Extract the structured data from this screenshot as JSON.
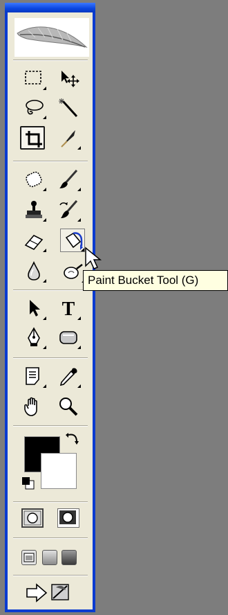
{
  "tooltip": {
    "text": "Paint Bucket Tool (G)"
  },
  "toolbox": {
    "colors": {
      "foreground": "#000000",
      "background": "#ffffff",
      "frame": "#0a3bd0"
    },
    "tools": [
      {
        "id": "marquee",
        "icon": "rectangular-marquee-icon"
      },
      {
        "id": "move",
        "icon": "move-icon"
      },
      {
        "id": "lasso",
        "icon": "lasso-icon"
      },
      {
        "id": "magic-wand",
        "icon": "magic-wand-icon"
      },
      {
        "id": "crop",
        "icon": "crop-icon",
        "selected": true
      },
      {
        "id": "slice",
        "icon": "slice-icon"
      },
      {
        "id": "healing-brush",
        "icon": "healing-brush-icon"
      },
      {
        "id": "brush",
        "icon": "brush-icon"
      },
      {
        "id": "clone-stamp",
        "icon": "clone-stamp-icon"
      },
      {
        "id": "history-brush",
        "icon": "history-brush-icon"
      },
      {
        "id": "eraser",
        "icon": "eraser-icon"
      },
      {
        "id": "paint-bucket",
        "icon": "paint-bucket-icon",
        "hover": true
      },
      {
        "id": "blur",
        "icon": "blur-icon"
      },
      {
        "id": "dodge",
        "icon": "dodge-icon"
      },
      {
        "id": "path-selection",
        "icon": "path-selection-icon"
      },
      {
        "id": "type",
        "icon": "type-icon",
        "glyph": "T"
      },
      {
        "id": "pen",
        "icon": "pen-icon"
      },
      {
        "id": "shape",
        "icon": "rounded-rectangle-icon"
      },
      {
        "id": "notes",
        "icon": "notes-icon"
      },
      {
        "id": "eyedropper",
        "icon": "eyedropper-icon"
      },
      {
        "id": "hand",
        "icon": "hand-icon"
      },
      {
        "id": "zoom",
        "icon": "zoom-icon"
      }
    ]
  }
}
